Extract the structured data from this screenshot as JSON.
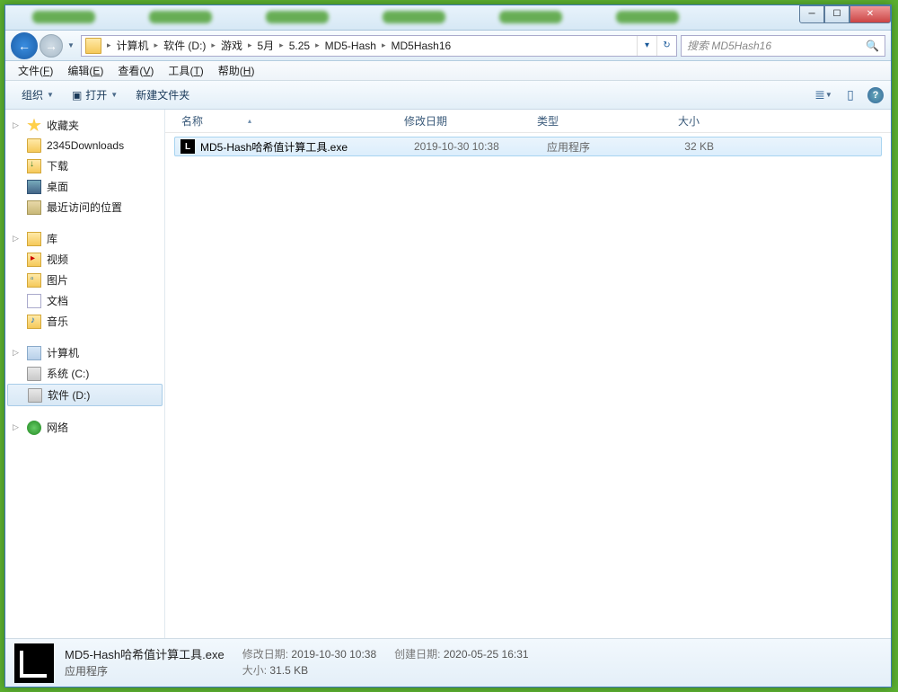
{
  "breadcrumbs": [
    "计算机",
    "软件 (D:)",
    "游戏",
    "5月",
    "5.25",
    "MD5-Hash",
    "MD5Hash16"
  ],
  "search": {
    "placeholder": "搜索 MD5Hash16"
  },
  "menubar": [
    {
      "label": "文件",
      "key": "F"
    },
    {
      "label": "编辑",
      "key": "E"
    },
    {
      "label": "查看",
      "key": "V"
    },
    {
      "label": "工具",
      "key": "T"
    },
    {
      "label": "帮助",
      "key": "H"
    }
  ],
  "commandbar": {
    "organize": "组织",
    "open": "打开",
    "newfolder": "新建文件夹"
  },
  "sidebar": {
    "favorites": {
      "label": "收藏夹",
      "items": [
        "2345Downloads",
        "下载",
        "桌面",
        "最近访问的位置"
      ]
    },
    "libraries": {
      "label": "库",
      "items": [
        "视频",
        "图片",
        "文档",
        "音乐"
      ]
    },
    "computer": {
      "label": "计算机",
      "items": [
        "系统 (C:)",
        "软件 (D:)"
      ],
      "selected": 1
    },
    "network": {
      "label": "网络"
    }
  },
  "columns": {
    "name": "名称",
    "date": "修改日期",
    "type": "类型",
    "size": "大小"
  },
  "files": [
    {
      "name": "MD5-Hash哈希值计算工具.exe",
      "date": "2019-10-30 10:38",
      "type": "应用程序",
      "size": "32 KB"
    }
  ],
  "details": {
    "name": "MD5-Hash哈希值计算工具.exe",
    "type": "应用程序",
    "date_label": "修改日期:",
    "date": "2019-10-30 10:38",
    "size_label": "大小:",
    "size": "31.5 KB",
    "created_label": "创建日期:",
    "created": "2020-05-25 16:31"
  }
}
